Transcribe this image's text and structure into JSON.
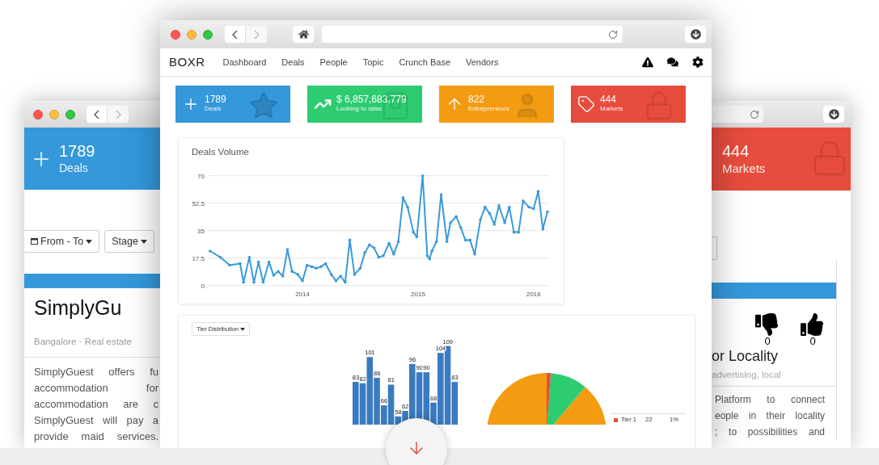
{
  "left_window": {
    "stat": {
      "value": "1789",
      "label": "Deals"
    },
    "filters": [
      {
        "label": "From - To",
        "kind": "date"
      },
      {
        "label": "Stage",
        "kind": "plain"
      }
    ],
    "card": {
      "title": "SimplyGu",
      "meta": "Bangalore · Real estate",
      "lines": [
        "SimplyGuest offers fu",
        "accommodation for",
        "accommodation are c",
        "SimplyGuest will pay a",
        "provide maid services."
      ]
    }
  },
  "main_window": {
    "brand": "BOXR",
    "nav": [
      {
        "label": "Dashboard"
      },
      {
        "label": "Deals"
      },
      {
        "label": "People"
      },
      {
        "label": "Topic"
      },
      {
        "label": "Crunch Base"
      },
      {
        "label": "Vendors"
      }
    ],
    "stats": [
      {
        "kind": "deals",
        "value": "1789",
        "label": "Deals",
        "color": "#3498db"
      },
      {
        "kind": "raise",
        "value": "$ 6,857,683,779",
        "label": "Looking to raise",
        "color": "#2ecc71"
      },
      {
        "kind": "entrepreneurs",
        "value": "822",
        "label": "Entrepreneurs",
        "color": "#f39c12"
      },
      {
        "kind": "markets",
        "value": "444",
        "label": "Markets",
        "color": "#e74c3c"
      }
    ],
    "deals_volume": {
      "title": "Deals Volume",
      "chart_data": {
        "type": "line",
        "grid": true,
        "xlim": [
          2013.17,
          2016.14
        ],
        "ylim": [
          0,
          70
        ],
        "yticks": [
          0,
          17.5,
          35,
          52.5,
          70
        ],
        "xticks": [
          {
            "value": 2014,
            "label": "2014"
          },
          {
            "value": 2015,
            "label": "2015"
          },
          {
            "value": 2016,
            "label": "2016"
          }
        ],
        "x": [
          2013.2,
          2013.29,
          2013.37,
          2013.46,
          2013.49,
          2013.54,
          2013.58,
          2013.62,
          2013.66,
          2013.71,
          2013.75,
          2013.79,
          2013.83,
          2013.87,
          2013.91,
          2013.96,
          2014.0,
          2014.04,
          2014.08,
          2014.12,
          2014.16,
          2014.2,
          2014.25,
          2014.29,
          2014.33,
          2014.37,
          2014.41,
          2014.45,
          2014.5,
          2014.54,
          2014.58,
          2014.62,
          2014.66,
          2014.7,
          2014.75,
          2014.79,
          2014.83,
          2014.87,
          2014.91,
          2014.96,
          2014.99,
          2015.04,
          2015.08,
          2015.1,
          2015.12,
          2015.16,
          2015.2,
          2015.25,
          2015.28,
          2015.33,
          2015.37,
          2015.41,
          2015.45,
          2015.49,
          2015.54,
          2015.58,
          2015.62,
          2015.66,
          2015.7,
          2015.75,
          2015.79,
          2015.83,
          2015.87,
          2015.91,
          2015.96,
          2016.0,
          2016.04,
          2016.08,
          2016.12
        ],
        "series": [
          {
            "color": "#3a9ad9",
            "values": [
              22,
              18,
              13,
              14,
              2,
              18,
              2,
              15,
              2,
              15,
              6.5,
              9,
              6,
              23,
              9,
              7,
              3,
              13,
              12,
              11,
              12,
              14,
              7,
              3,
              6,
              2,
              29,
              7,
              11,
              21,
              26,
              24,
              18,
              19,
              27,
              20,
              28,
              56,
              50,
              34,
              31,
              70,
              19,
              17,
              22,
              28,
              58,
              28,
              40,
              44,
              37,
              29,
              29,
              20,
              42,
              50,
              46,
              39,
              51,
              40,
              50,
              34,
              34,
              54,
              50,
              49,
              60,
              36,
              47
            ]
          }
        ]
      }
    },
    "tier": {
      "dropdown": "Tier Distribution",
      "chart_data": {
        "type": "bar",
        "categories": [
          null,
          null,
          null,
          null,
          null,
          null,
          null,
          null,
          null,
          null,
          null,
          null,
          null,
          null,
          null
        ],
        "data_labels": true,
        "series": [
          {
            "color": "#3a7bbf",
            "values": [
              83,
              82,
              101,
              86,
              66,
              81,
              58,
              62,
              96,
              90,
              90,
              68,
              104,
              109,
              83
            ]
          }
        ]
      },
      "pie_legend": [
        {
          "label": "Tier 1",
          "count": "22",
          "share": "1%",
          "color": "#e74c3c"
        }
      ]
    }
  },
  "right_window": {
    "stat": {
      "value": "444",
      "label": "Markets"
    },
    "votes": [
      {
        "kind": "down",
        "count": "0"
      },
      {
        "kind": "up",
        "count": "0"
      }
    ],
    "card": {
      "title": "or Locality",
      "meta": "advertising, local",
      "lines": [
        "Platform to connect",
        "eople in their locality",
        "; to possibilities and"
      ]
    }
  }
}
